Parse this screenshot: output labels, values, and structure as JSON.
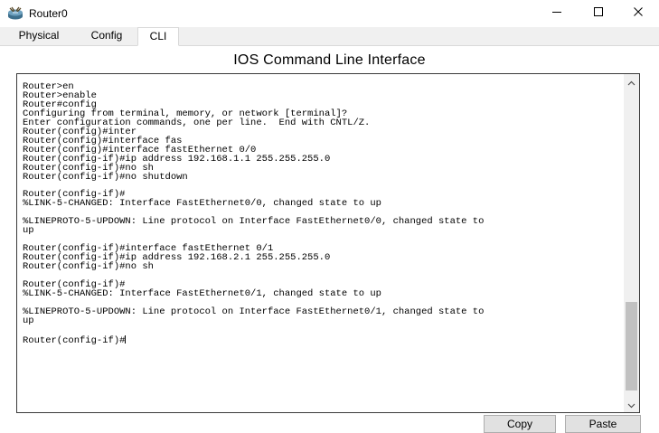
{
  "window": {
    "title": "Router0",
    "controls": {
      "minimize": "minimize",
      "maximize": "maximize",
      "close": "close"
    }
  },
  "tabs": [
    {
      "label": "Physical",
      "active": false
    },
    {
      "label": "Config",
      "active": false
    },
    {
      "label": "CLI",
      "active": true
    }
  ],
  "cli": {
    "heading": "IOS Command Line Interface",
    "output": "Router>en\nRouter>enable\nRouter#config\nConfiguring from terminal, memory, or network [terminal]?\nEnter configuration commands, one per line.  End with CNTL/Z.\nRouter(config)#inter\nRouter(config)#interface fas\nRouter(config)#interface fastEthernet 0/0\nRouter(config-if)#ip address 192.168.1.1 255.255.255.0\nRouter(config-if)#no sh\nRouter(config-if)#no shutdown\n\nRouter(config-if)#\n%LINK-5-CHANGED: Interface FastEthernet0/0, changed state to up\n\n%LINEPROTO-5-UPDOWN: Line protocol on Interface FastEthernet0/0, changed state to\nup\n\nRouter(config-if)#interface fastEthernet 0/1\nRouter(config-if)#ip address 192.168.2.1 255.255.255.0\nRouter(config-if)#no sh\n\nRouter(config-if)#\n%LINK-5-CHANGED: Interface FastEthernet0/1, changed state to up\n\n%LINEPROTO-5-UPDOWN: Line protocol on Interface FastEthernet0/1, changed state to\nup\n\n",
    "prompt": "Router(config-if)#"
  },
  "buttons": {
    "copy": "Copy",
    "paste": "Paste"
  },
  "icons": {
    "app": "router-icon",
    "minimize": "minimize-icon",
    "maximize": "maximize-icon",
    "close": "close-icon",
    "scroll_up": "chevron-up-icon",
    "scroll_down": "chevron-down-icon"
  },
  "colors": {
    "tab_bar": "#f0f0f0",
    "button_face": "#e1e1e1",
    "terminal_border": "#3a3a3a",
    "scroll_thumb": "#c1c1c1"
  }
}
